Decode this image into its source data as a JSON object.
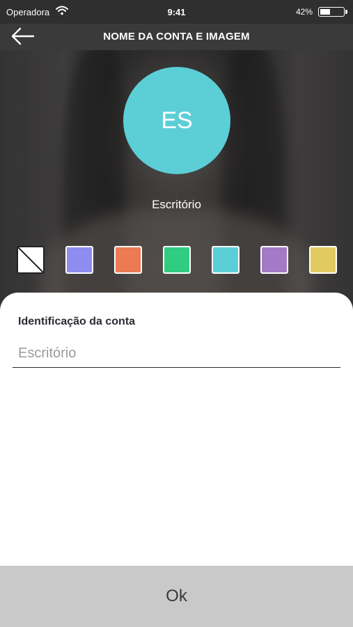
{
  "status_bar": {
    "carrier": "Operadora",
    "time": "9:41",
    "battery": "42%"
  },
  "nav": {
    "title": "NOME DA CONTA E IMAGEM"
  },
  "avatar": {
    "initials": "ES",
    "color": "#5ccfd6"
  },
  "account_name": "Escritório",
  "swatches": [
    {
      "name": "none",
      "color": "none"
    },
    {
      "name": "periwinkle",
      "color": "#8f8cf0"
    },
    {
      "name": "orange",
      "color": "#ec7a53"
    },
    {
      "name": "green",
      "color": "#30cc80"
    },
    {
      "name": "teal",
      "color": "#5ccfd6"
    },
    {
      "name": "purple",
      "color": "#a47ac6"
    },
    {
      "name": "yellow",
      "color": "#e2ca63"
    }
  ],
  "form": {
    "label": "Identificação da conta",
    "placeholder": "Escritório",
    "value": ""
  },
  "ok_button": "Ok"
}
